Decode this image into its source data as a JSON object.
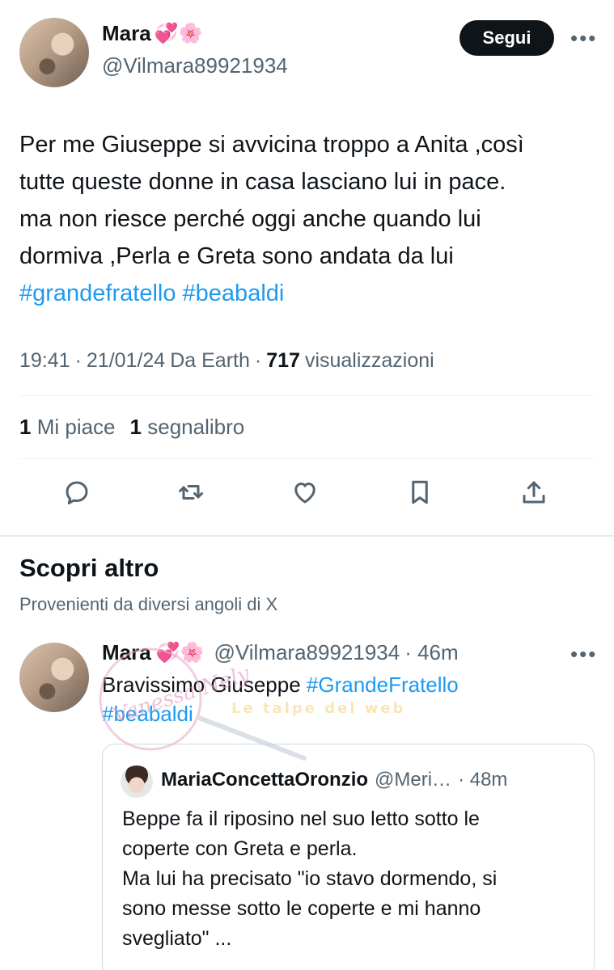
{
  "tweet": {
    "author_name": "Mara",
    "author_emojis": "💞🌸",
    "author_handle": "@Vilmara89921934",
    "follow_label": "Segui",
    "more_label": "•••",
    "text_lines": [
      "Per me Giuseppe si avvicina troppo a Anita ,così",
      "tutte queste donne in casa lasciano lui in pace.",
      "ma non riesce perché oggi anche quando lui",
      "dormiva ,Perla e Greta sono andata da lui"
    ],
    "hashtags": [
      "#grandefratello",
      "#beabaldi"
    ],
    "time": "19:41",
    "date": "21/01/24",
    "source": "Da Earth",
    "views_count": "717",
    "views_label": "visualizzazioni",
    "likes_count": "1",
    "likes_label": "Mi piace",
    "bookmarks_count": "1",
    "bookmarks_label": "segnalibro",
    "actions": [
      "reply-icon",
      "retweet-icon",
      "like-icon",
      "bookmark-icon",
      "share-icon"
    ]
  },
  "discover": {
    "title": "Scopri altro",
    "subtitle": "Provenienti da diversi angoli di X"
  },
  "related_tweet": {
    "author_name": "Mara",
    "author_emojis": "💞🌸",
    "author_handle": "@Vilmara89921934",
    "age": "· 46m",
    "more_label": "•••",
    "text": "Bravissimo Giuseppe ",
    "hashtag1": "#GrandeFratello",
    "hashtag2": "#beabaldi",
    "quote": {
      "author_name": "MariaConcettaOronzio",
      "author_handle": "@Meri…",
      "age": "· 48m",
      "text_lines": [
        "Beppe fa il riposino nel suo letto sotto le",
        "coperte con Greta e perla.",
        "Ma lui ha precisato \"io stavo dormendo, si",
        "sono messe sotto le coperte e mi hanno",
        "svegliato\" ..."
      ]
    }
  },
  "watermark": {
    "text1": "Vanessa Nely",
    "text2": "Le talpe del web"
  },
  "colors": {
    "accent": "#1d9bf0",
    "text": "#0f1419",
    "muted": "#536471"
  }
}
